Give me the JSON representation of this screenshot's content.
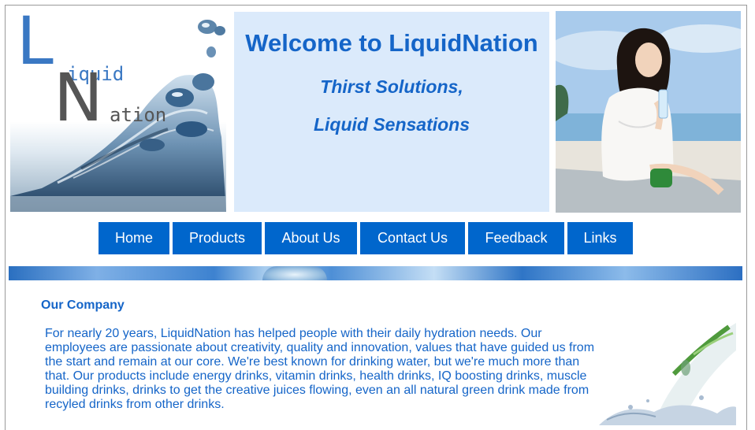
{
  "logo": {
    "letter_l": "L",
    "letter_n": "N",
    "word_liquid": "iquid",
    "word_nation": "ation"
  },
  "welcome": {
    "title": "Welcome to LiquidNation",
    "tagline_1": "Thirst Solutions,",
    "tagline_2": "Liquid Sensations"
  },
  "nav": {
    "items": [
      {
        "label": "Home"
      },
      {
        "label": "Products"
      },
      {
        "label": "About Us"
      },
      {
        "label": "Contact Us"
      },
      {
        "label": "Feedback"
      },
      {
        "label": "Links"
      }
    ]
  },
  "content": {
    "section_title": "Our Company",
    "paragraph": "For nearly 20 years, LiquidNation has helped people with their daily hydration needs. Our employees are passionate about creativity, quality and innovation, values that have guided us from the start and remain at our core. We're best known for drinking water, but we're much more than that. Our products include energy drinks, vitamin drinks, health drinks, IQ boosting drinks, muscle building drinks, drinks to get the creative juices flowing, even an all natural green drink made from recyled drinks from other drinks."
  },
  "colors": {
    "brand_blue": "#0066cc",
    "text_blue": "#1565c8",
    "welcome_bg": "#dbeafb"
  }
}
